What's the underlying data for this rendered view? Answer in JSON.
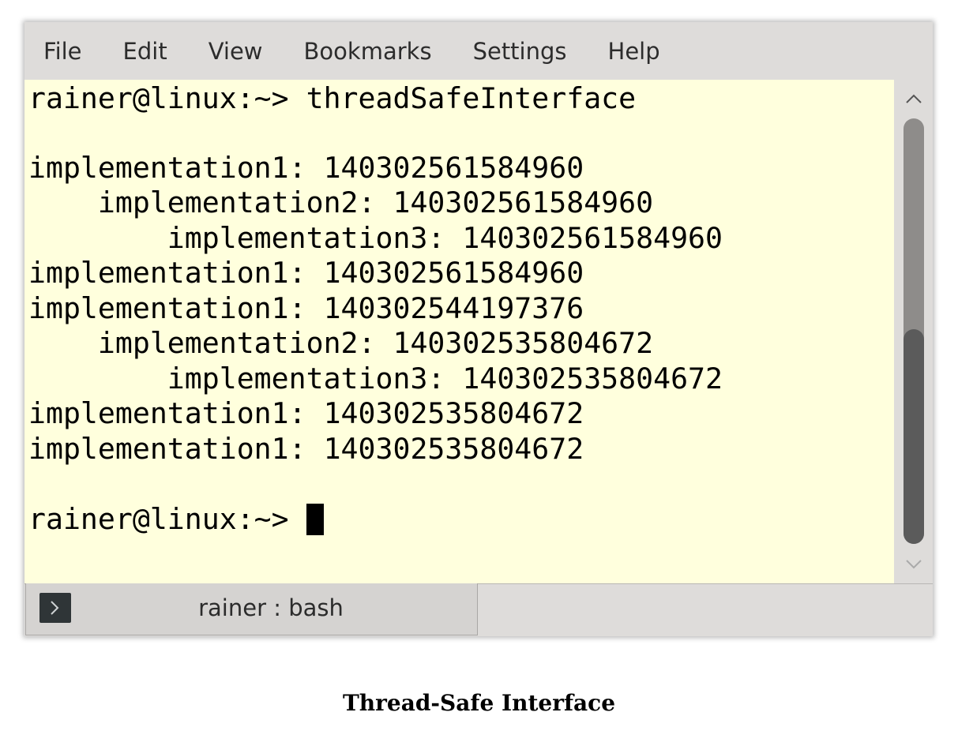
{
  "menubar": {
    "items": [
      "File",
      "Edit",
      "View",
      "Bookmarks",
      "Settings",
      "Help"
    ]
  },
  "terminal": {
    "lines": [
      "rainer@linux:~> threadSafeInterface",
      "",
      "implementation1: 140302561584960",
      "    implementation2: 140302561584960",
      "        implementation3: 140302561584960",
      "implementation1: 140302561584960",
      "implementation1: 140302544197376",
      "    implementation2: 140302535804672",
      "        implementation3: 140302535804672",
      "implementation1: 140302535804672",
      "implementation1: 140302535804672",
      "",
      "rainer@linux:~> "
    ],
    "background": "#ffffdd",
    "foreground": "#000000"
  },
  "scrollbar": {
    "up_icon": "chevron-up-icon",
    "down_icon": "chevron-down-icon"
  },
  "tabbar": {
    "tab_label": "rainer : bash",
    "tab_icon": "terminal-prompt-icon"
  },
  "caption": "Thread-Safe Interface"
}
